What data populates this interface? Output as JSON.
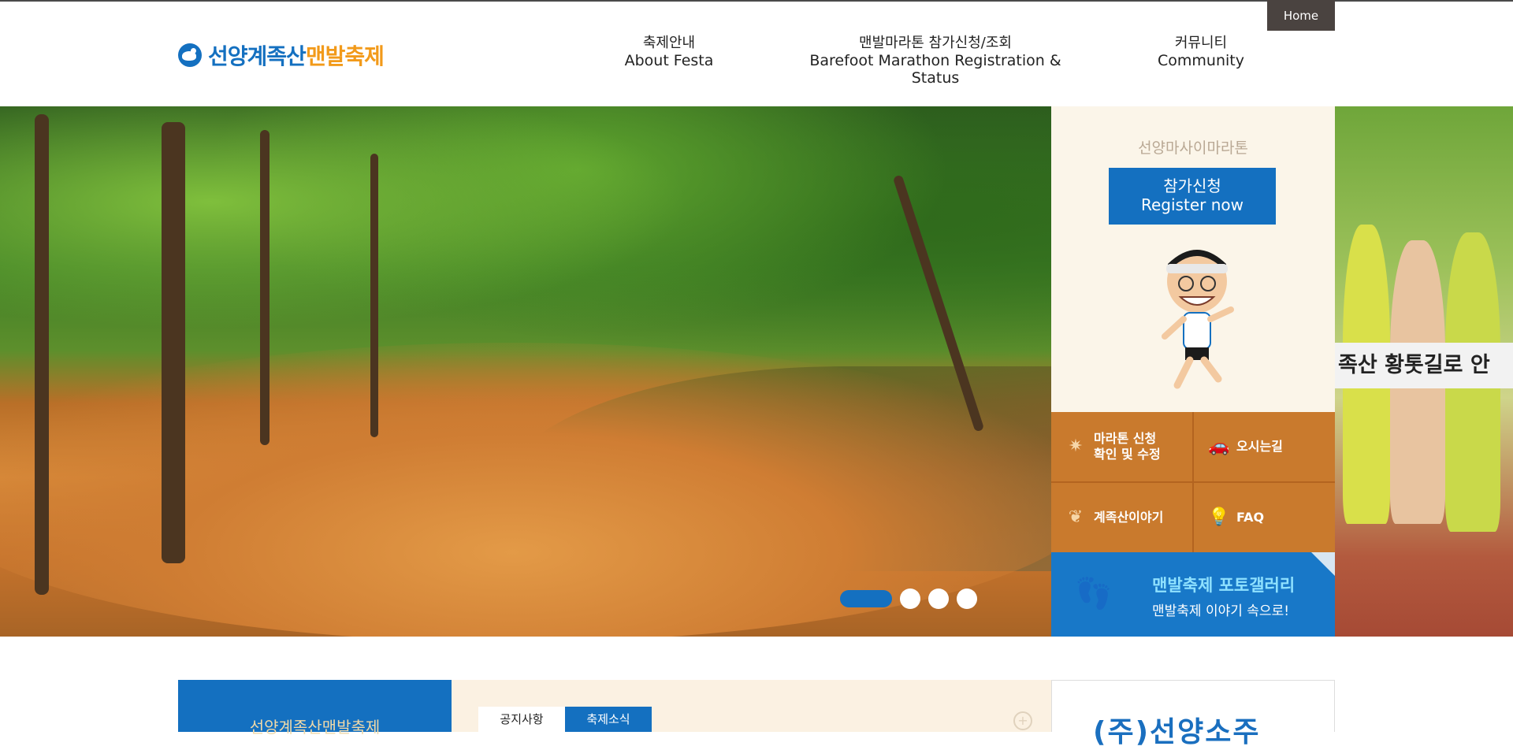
{
  "header": {
    "home_label": "Home",
    "logo_main": "선양계족산",
    "logo_highlight": "맨발축제",
    "nav": [
      {
        "ko": "축제안내",
        "en": "About Festa"
      },
      {
        "ko": "맨발마라톤 참가신청/조회",
        "en": "Barefoot Marathon Registration & Status"
      },
      {
        "ko": "커뮤니티",
        "en": "Community"
      }
    ]
  },
  "hero": {
    "slides_total": 4,
    "active_slide": 1
  },
  "side": {
    "promo_title": "선양마사이마라톤",
    "register_ko": "참가신청",
    "register_en": "Register now",
    "quick_links": [
      {
        "label1": "마라톤 신청",
        "label2": "확인 및 수정",
        "icon": "star-icon"
      },
      {
        "label1": "오시는길",
        "label2": "",
        "icon": "car-icon"
      },
      {
        "label1": "계족산이야기",
        "label2": "",
        "icon": "leaf-icon"
      },
      {
        "label1": "FAQ",
        "label2": "",
        "icon": "lightbulb-icon"
      }
    ],
    "gallery_title": "맨발축제 포토갤러리",
    "gallery_sub": "맨발축제 이야기 속으로!"
  },
  "right_banner_text": "족산 황톳길로 안",
  "bottom": {
    "left_title": "선양계족산맨발축제",
    "tabs": [
      "공지사항",
      "축제소식"
    ],
    "sponsor": "(주)선양소주"
  },
  "colors": {
    "brand_blue": "#1470c0",
    "accent_orange": "#f29a1a",
    "quick_link_bg": "#c97a2d",
    "promo_bg": "#fbf5e9"
  }
}
